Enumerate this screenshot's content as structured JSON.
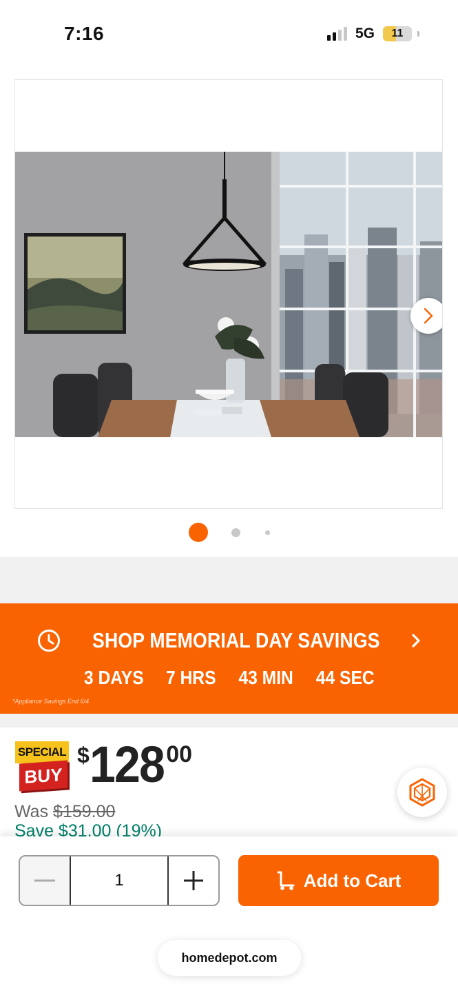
{
  "status_bar": {
    "time": "7:16",
    "network": "5G",
    "battery_level": "11",
    "battery_color": "#f2c94c"
  },
  "gallery": {
    "next_icon": "chevron-right-icon",
    "slide_count": 3,
    "active_slide": 1
  },
  "promo": {
    "title": "SHOP MEMORIAL DAY SAVINGS",
    "icon": "clock-icon",
    "countdown": [
      "3 DAYS",
      "7 HRS",
      "43 MIN",
      "44 SEC"
    ],
    "fine_print": "*Appliance Savings End 6/4",
    "background": "#f96302"
  },
  "pricing": {
    "badge_top": "SPECIAL",
    "badge_bottom": "BUY",
    "currency": "$",
    "dollars": "128",
    "cents": "00",
    "was_label": "Was ",
    "was_price": "$159.00",
    "save_text": "Save $31.00 (19%)"
  },
  "cart": {
    "quantity": "1",
    "minus_icon": "minus-icon",
    "plus_icon": "plus-icon",
    "add_label": "Add to Cart",
    "cart_icon": "dolly-cart-icon",
    "accent": "#f96302"
  },
  "browser": {
    "url": "homedepot.com"
  }
}
